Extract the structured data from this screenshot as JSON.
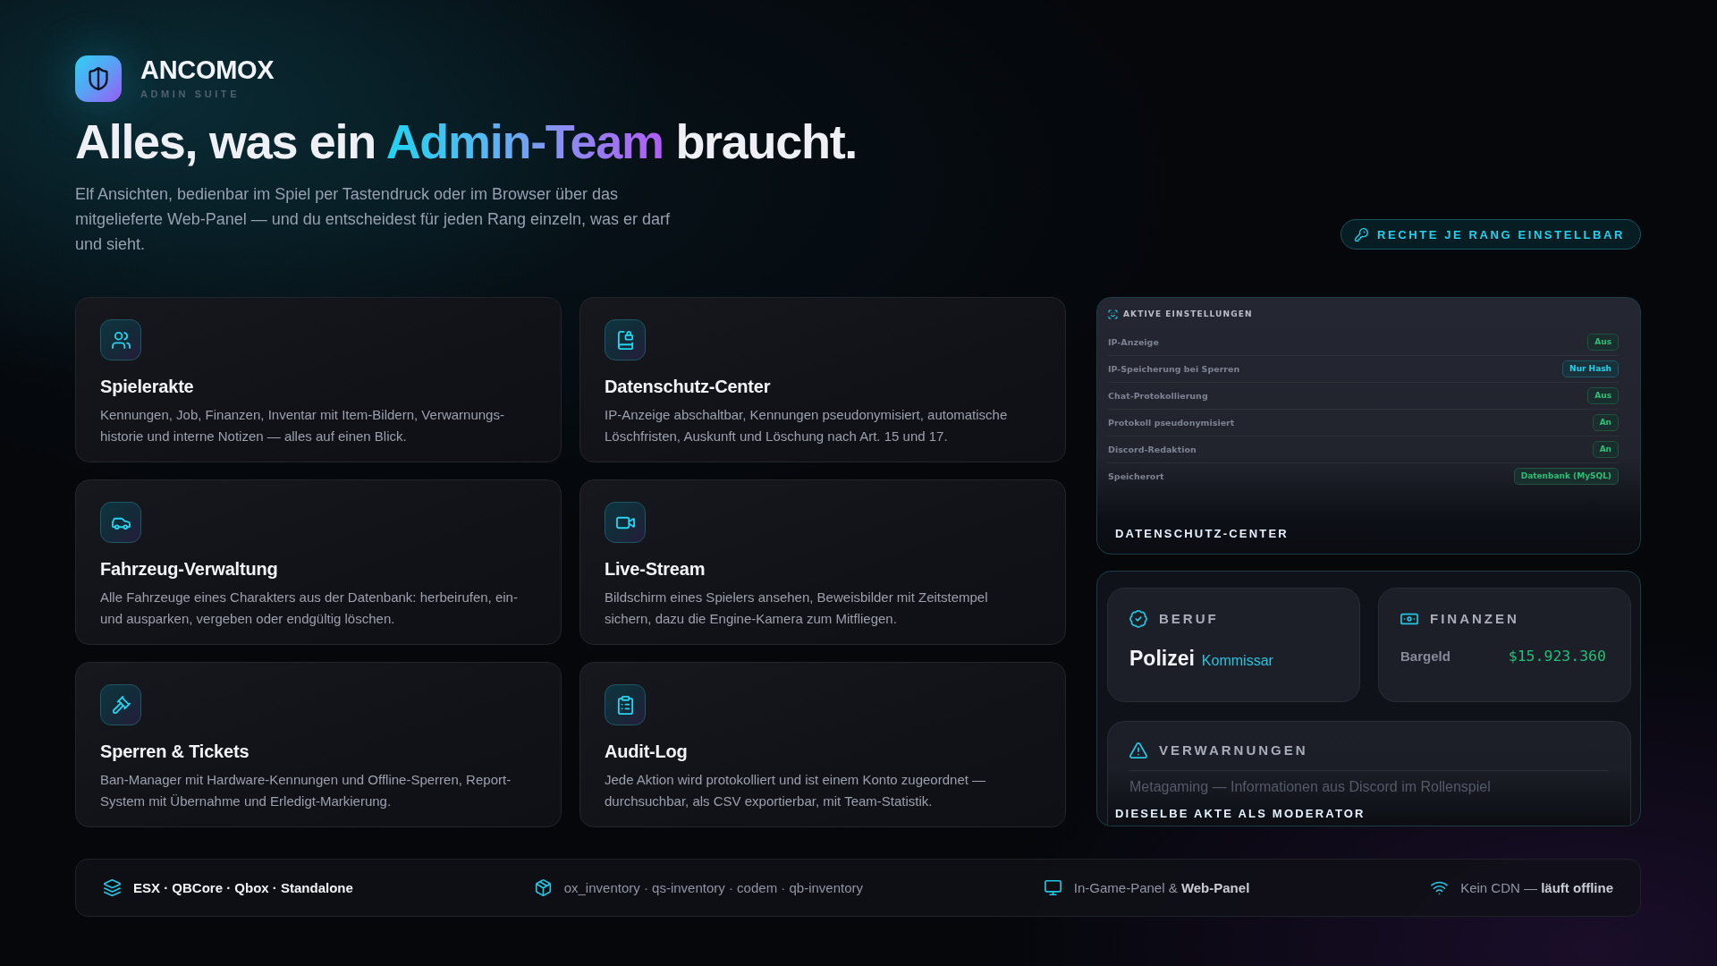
{
  "brand": {
    "name": "ANCOMOX",
    "tagline": "ADMIN SUITE"
  },
  "headline": {
    "lead": "Alles, was ein ",
    "accent": "Admin-Team",
    "tail": " braucht."
  },
  "intro": "Elf Ansichten, bedienbar im Spiel per Tastendruck oder im Browser über das mitgelieferte Web-Panel — und du entscheidest für jeden Rang einzeln, was er darf und sieht.",
  "permissions_tag": "RECHTE JE RANG EINSTELLBAR",
  "features": [
    {
      "title": "Spielerakte",
      "description": "Kennungen, Job, Finanzen, Inventar mit Item-Bildern, Verwarnungs-historie und interne Notizen — alles auf einen Blick."
    },
    {
      "title": "Datenschutz-Center",
      "description": "IP-Anzeige abschaltbar, Kennungen pseudonymisiert, automatische Löschfristen, Auskunft und Löschung nach Art. 15 und 17."
    },
    {
      "title": "Fahrzeug-Verwaltung",
      "description": "Alle Fahrzeuge eines Charakters aus der Datenbank: herbeirufen, ein- und ausparken, vergeben oder endgültig löschen."
    },
    {
      "title": "Live-Stream",
      "description": "Bildschirm eines Spielers ansehen, Beweisbilder mit Zeitstempel sichern, dazu die Engine-Kamera zum Mitfliegen."
    },
    {
      "title": "Sperren & Tickets",
      "description": "Ban-Manager mit Hardware-Kennungen und Offline-Sperren, Report-System mit Übernahme und Erledigt-Markierung."
    },
    {
      "title": "Audit-Log",
      "description": "Jede Aktion wird protokolliert und ist einem Konto zugeordnet — durchsuchbar, als CSV exportierbar, mit Team-Statistik."
    }
  ],
  "settings_preview": {
    "title": "AKTIVE EINSTELLUNGEN",
    "rows": [
      {
        "label": "IP-Anzeige",
        "value": "Aus",
        "color": "#2cbf78"
      },
      {
        "label": "IP-Speicherung bei Sperren",
        "value": "Nur Hash",
        "color": "#22d3ee"
      },
      {
        "label": "Chat-Protokollierung",
        "value": "Aus",
        "color": "#2cbf78"
      },
      {
        "label": "Protokoll pseudonymisiert",
        "value": "An",
        "color": "#2cbf78"
      },
      {
        "label": "Discord-Redaktion",
        "value": "An",
        "color": "#2cbf78"
      },
      {
        "label": "Speicherort",
        "value": "Datenbank (MySQL)",
        "color": "#2cbf78"
      }
    ],
    "caption": "DATENSCHUTZ-CENTER"
  },
  "record_preview": {
    "job": {
      "heading": "BERUF",
      "name": "Polizei",
      "rank": "Kommissar"
    },
    "finances": {
      "heading": "FINANZEN",
      "label": "Bargeld",
      "amount": "$15.923.360"
    },
    "warnings": {
      "heading": "VERWARNUNGEN",
      "entries": [
        "Metagaming — Informationen aus Discord im Rollenspiel"
      ]
    },
    "caption": "DIESELBE AKTE ALS MODERATOR"
  },
  "footer": [
    {
      "text": "ESX · QBCore · Qbox · Standalone",
      "strong": true
    },
    {
      "text": "ox_inventory · qs-inventory · codem · qb-inventory",
      "strong": false
    },
    {
      "text": "In-Game-Panel & **Web-Panel**",
      "strong": false
    },
    {
      "text": "Kein CDN — **läuft offline**",
      "strong": false
    }
  ]
}
